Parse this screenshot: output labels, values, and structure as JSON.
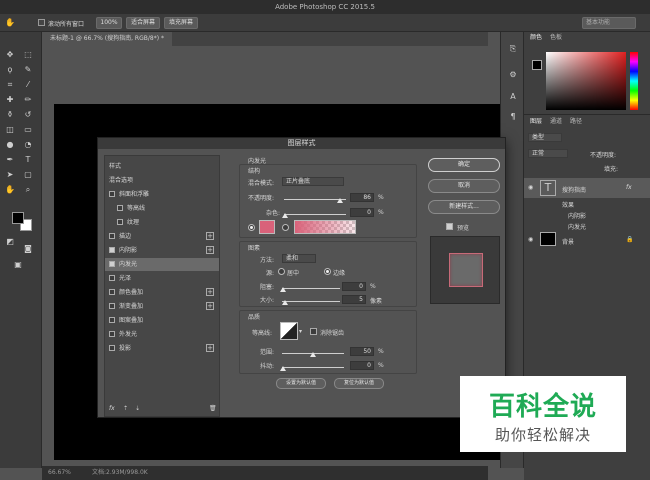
{
  "window": {
    "title": "Adobe Photoshop CC 2015.5"
  },
  "options_bar": {
    "scroll_all_windows": "滚动所有窗口",
    "zoom_100": "100%",
    "fit_screen": "适合屏幕",
    "fill_screen": "填充屏幕",
    "workspace": "基本功能"
  },
  "document": {
    "tab_title": "未标题-1 @ 66.7% (搜狗指南, RGB/8*) *",
    "zoom": "66.67%",
    "doc_info": "文档:2.93M/998.0K"
  },
  "panels": {
    "color_tabs": [
      "颜色",
      "色板"
    ],
    "layers_tabs": [
      "图层",
      "通道",
      "路径"
    ],
    "filter_kind": "类型",
    "blend_mode": "正常",
    "opacity_label": "不透明度:",
    "fill_label": "填充:",
    "layers": [
      {
        "name": "搜狗指南",
        "type": "text",
        "fx": "fx"
      },
      {
        "name": "效果"
      },
      {
        "name": "内阴影"
      },
      {
        "name": "内发光"
      },
      {
        "name": "背景"
      }
    ]
  },
  "dialog": {
    "title": "图层样式",
    "styles_header": "样式",
    "style_items": [
      {
        "label": "混合选项",
        "check": false,
        "has_check": false,
        "plus": false
      },
      {
        "label": "斜面和浮雕",
        "check": false,
        "has_check": true,
        "plus": false
      },
      {
        "label": "等高线",
        "check": false,
        "has_check": true,
        "plus": false,
        "indent": true
      },
      {
        "label": "纹理",
        "check": false,
        "has_check": true,
        "plus": false,
        "indent": true
      },
      {
        "label": "描边",
        "check": false,
        "has_check": true,
        "plus": true
      },
      {
        "label": "内阴影",
        "check": true,
        "has_check": true,
        "plus": true
      },
      {
        "label": "内发光",
        "check": true,
        "has_check": true,
        "plus": false,
        "selected": true
      },
      {
        "label": "光泽",
        "check": false,
        "has_check": true,
        "plus": false
      },
      {
        "label": "颜色叠加",
        "check": false,
        "has_check": true,
        "plus": true
      },
      {
        "label": "渐变叠加",
        "check": false,
        "has_check": true,
        "plus": true
      },
      {
        "label": "图案叠加",
        "check": false,
        "has_check": true,
        "plus": false
      },
      {
        "label": "外发光",
        "check": false,
        "has_check": true,
        "plus": false
      },
      {
        "label": "投影",
        "check": false,
        "has_check": true,
        "plus": true
      }
    ],
    "footer_fx": "fx",
    "section_title": "内发光",
    "structure": {
      "title": "结构",
      "blend_mode_label": "混合模式:",
      "blend_mode_value": "正片叠底",
      "opacity_label": "不透明度:",
      "opacity_value": "86",
      "noise_label": "杂色:",
      "noise_value": "0",
      "percent": "%",
      "solid_color": "#d9627a"
    },
    "elements": {
      "title": "图素",
      "method_label": "方法:",
      "method_value": "柔和",
      "source_label": "源:",
      "source_center": "居中",
      "source_edge": "边缘",
      "choke_label": "阻塞:",
      "choke_value": "0",
      "size_label": "大小:",
      "size_value": "5",
      "px": "像素",
      "percent": "%"
    },
    "quality": {
      "title": "品质",
      "contour_label": "等高线:",
      "anti_alias": "消除锯齿",
      "range_label": "范围:",
      "range_value": "50",
      "jitter_label": "抖动:",
      "jitter_value": "0",
      "percent": "%"
    },
    "make_default": "设置为默认值",
    "reset_default": "复位为默认值",
    "ok": "确定",
    "cancel": "取消",
    "new_style": "新建样式...",
    "preview": "预览"
  },
  "watermark": {
    "title": "百科全说",
    "subtitle": "助你轻松解决"
  }
}
